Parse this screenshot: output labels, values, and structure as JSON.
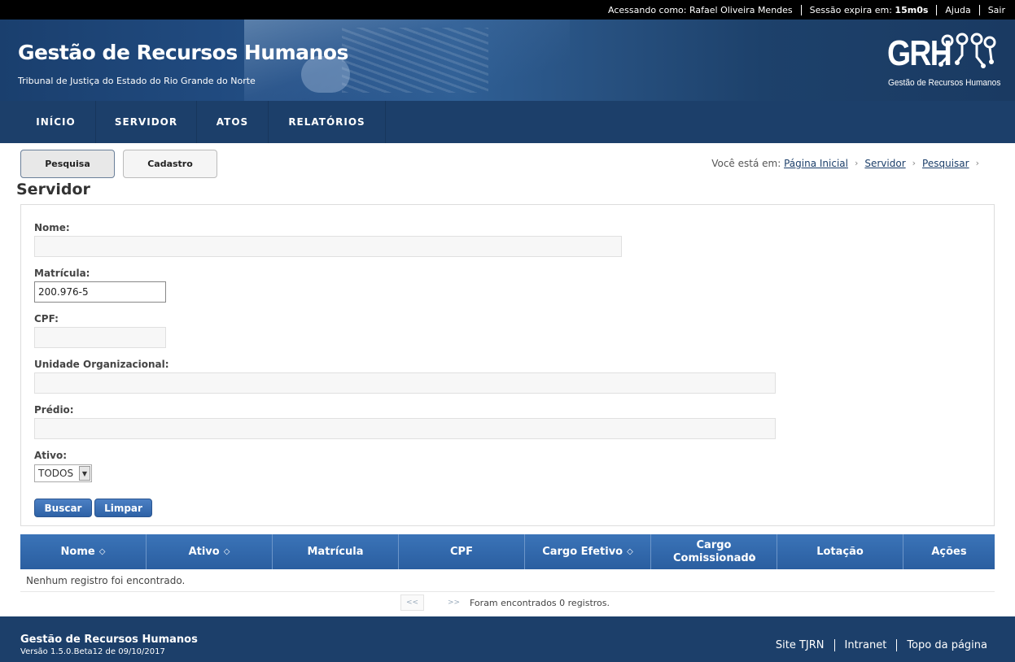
{
  "topbar": {
    "user_label": "Acessando como:",
    "user_name": "Rafael Oliveira Mendes",
    "session_label": "Sessão expira em:",
    "session_time": "15m0s",
    "help": "Ajuda",
    "logout": "Sair"
  },
  "header": {
    "title": "Gestão de Recursos Humanos",
    "subtitle": "Tribunal de Justiça do Estado do Rio Grande do Norte",
    "logo_text": "GRH",
    "logo_caption": "Gestão de Recursos Humanos"
  },
  "nav": {
    "items": [
      "INÍCIO",
      "SERVIDOR",
      "ATOS",
      "RELATÓRIOS"
    ]
  },
  "tabs": {
    "search": "Pesquisa",
    "register": "Cadastro"
  },
  "breadcrumb": {
    "prefix": "Você está em:",
    "items": [
      "Página Inicial",
      "Servidor",
      "Pesquisar"
    ]
  },
  "page_title": "Servidor",
  "form": {
    "nome_label": "Nome:",
    "nome_value": "",
    "matricula_label": "Matrícula:",
    "matricula_value": "200.976-5",
    "cpf_label": "CPF:",
    "cpf_value": "",
    "unidade_label": "Unidade Organizacional:",
    "unidade_value": "",
    "predio_label": "Prédio:",
    "predio_value": "",
    "ativo_label": "Ativo:",
    "ativo_selected": "TODOS",
    "search_button": "Buscar",
    "clear_button": "Limpar"
  },
  "table": {
    "columns": [
      {
        "label": "Nome",
        "sortable": true
      },
      {
        "label": "Ativo",
        "sortable": true
      },
      {
        "label": "Matrícula",
        "sortable": false
      },
      {
        "label": "CPF",
        "sortable": false
      },
      {
        "label": "Cargo Efetivo",
        "sortable": true
      },
      {
        "label": "Cargo Comissionado",
        "sortable": true
      },
      {
        "label": "Lotação",
        "sortable": false
      },
      {
        "label": "Ações",
        "sortable": false
      }
    ],
    "empty_message": "Nenhum registro foi encontrado.",
    "pager_prev": "<<",
    "pager_next": ">>",
    "records_found": "Foram encontrados 0 registros."
  },
  "footer": {
    "title": "Gestão de Recursos Humanos",
    "version": "Versão 1.5.0.Beta12 de 09/10/2017",
    "links": [
      "Site TJRN",
      "Intranet",
      "Topo da página"
    ]
  },
  "colors": {
    "brand_dark": "#1c3f6a",
    "button_blue": "#3b74b8"
  }
}
